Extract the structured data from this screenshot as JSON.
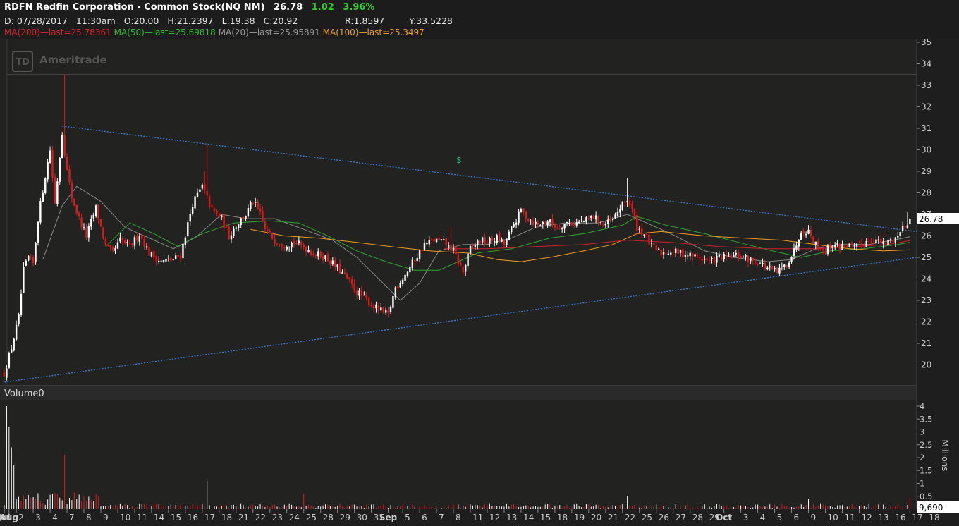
{
  "header": {
    "symbol": "RDFN",
    "company": "Redfin Corporation - Common Stock(NQ NM)",
    "last": "26.78",
    "change": "1.02",
    "change_pct": "3.96%",
    "date_label": "D:",
    "date": "07/28/2017",
    "time": "11:30am",
    "open": "O:20.00",
    "high": "H:21.2397",
    "low": "L:19.38",
    "close": "C:20.92",
    "r": "R:1.8597",
    "y": "Y:33.5228"
  },
  "studies": [
    {
      "label": "MA(200)",
      "value": "last=25.78361",
      "color": "#e0222a"
    },
    {
      "label": "MA(50)",
      "value": "last=25.69818",
      "color": "#2fbf2f"
    },
    {
      "label": "MA(20)",
      "value": "last=25.95891",
      "color": "#9a9a9a"
    },
    {
      "label": "MA(100)",
      "value": "last=25.3497",
      "color": "#f0a020"
    }
  ],
  "watermark": "Ameritrade",
  "watermark_logo": "TD",
  "dividend_marker": "$",
  "volume_label": "Volume",
  "volume_value": "0",
  "volume_units": "Millions",
  "volume_last": "9,690",
  "last_price_tag": "26.78",
  "colors": {
    "up": "#ffffff",
    "down": "#e01818",
    "trend": "#3a7fd8",
    "bg": "#1e1e1e"
  },
  "chart_data": {
    "type": "candlestick",
    "price_axis": {
      "min": 19,
      "max": 35,
      "ticks": [
        20,
        21,
        22,
        23,
        24,
        25,
        26,
        27,
        28,
        29,
        30,
        31,
        32,
        33,
        34,
        35
      ]
    },
    "volume_axis": {
      "min": 0,
      "max": 4,
      "ticks": [
        0.5,
        1,
        1.5,
        2,
        2.5,
        3,
        3.5,
        4
      ]
    },
    "x_ticks": [
      {
        "label": "Jul",
        "bar": 0
      },
      {
        "label": "Aug",
        "bar": 2
      },
      {
        "label": "2",
        "bar": 5
      },
      {
        "label": "3",
        "bar": 12
      },
      {
        "label": "4",
        "bar": 19
      },
      {
        "label": "7",
        "bar": 26
      },
      {
        "label": "8",
        "bar": 33
      },
      {
        "label": "9",
        "bar": 40
      },
      {
        "label": "10",
        "bar": 47
      },
      {
        "label": "11",
        "bar": 54
      },
      {
        "label": "14",
        "bar": 61
      },
      {
        "label": "15",
        "bar": 68
      },
      {
        "label": "16",
        "bar": 75
      },
      {
        "label": "17",
        "bar": 82
      },
      {
        "label": "18",
        "bar": 89
      },
      {
        "label": "21",
        "bar": 96
      },
      {
        "label": "22",
        "bar": 103
      },
      {
        "label": "23",
        "bar": 110
      },
      {
        "label": "24",
        "bar": 117
      },
      {
        "label": "25",
        "bar": 124
      },
      {
        "label": "28",
        "bar": 131
      },
      {
        "label": "29",
        "bar": 138
      },
      {
        "label": "30",
        "bar": 145
      },
      {
        "label": "31",
        "bar": 152
      },
      {
        "label": "Sep",
        "bar": 159
      },
      {
        "label": "5",
        "bar": 165
      },
      {
        "label": "6",
        "bar": 172
      },
      {
        "label": "7",
        "bar": 179
      },
      {
        "label": "8",
        "bar": 186
      },
      {
        "label": "11",
        "bar": 193
      },
      {
        "label": "12",
        "bar": 200
      },
      {
        "label": "13",
        "bar": 207
      },
      {
        "label": "14",
        "bar": 214
      },
      {
        "label": "15",
        "bar": 221
      },
      {
        "label": "18",
        "bar": 228
      },
      {
        "label": "19",
        "bar": 235
      },
      {
        "label": "20",
        "bar": 242
      },
      {
        "label": "21",
        "bar": 249
      },
      {
        "label": "22",
        "bar": 256
      },
      {
        "label": "25",
        "bar": 263
      },
      {
        "label": "26",
        "bar": 270
      },
      {
        "label": "27",
        "bar": 277
      },
      {
        "label": "28",
        "bar": 284
      },
      {
        "label": "29",
        "bar": 291
      },
      {
        "label": "Oct",
        "bar": 298
      },
      {
        "label": "3",
        "bar": 305
      },
      {
        "label": "4",
        "bar": 312
      },
      {
        "label": "5",
        "bar": 319
      },
      {
        "label": "6",
        "bar": 326
      },
      {
        "label": "9",
        "bar": 333
      },
      {
        "label": "10",
        "bar": 340
      },
      {
        "label": "11",
        "bar": 347
      },
      {
        "label": "12",
        "bar": 354
      },
      {
        "label": "13",
        "bar": 361
      },
      {
        "label": "16",
        "bar": 368
      },
      {
        "label": "17",
        "bar": 375
      },
      {
        "label": "18",
        "bar": 382
      }
    ],
    "anchors": [
      [
        0,
        19.6
      ],
      [
        3,
        20.8
      ],
      [
        6,
        22.2
      ],
      [
        8,
        24.4
      ],
      [
        10,
        25.0
      ],
      [
        12,
        24.7
      ],
      [
        14,
        26.8
      ],
      [
        17,
        28.8
      ],
      [
        19,
        30.0
      ],
      [
        21,
        27.5
      ],
      [
        24,
        30.8
      ],
      [
        26,
        29.0
      ],
      [
        28,
        27.8
      ],
      [
        31,
        26.8
      ],
      [
        34,
        26.0
      ],
      [
        38,
        27.3
      ],
      [
        42,
        25.5
      ],
      [
        45,
        25.2
      ],
      [
        48,
        25.8
      ],
      [
        52,
        25.5
      ],
      [
        56,
        26.1
      ],
      [
        60,
        25.2
      ],
      [
        65,
        24.8
      ],
      [
        70,
        24.9
      ],
      [
        73,
        25.1
      ],
      [
        78,
        27.5
      ],
      [
        82,
        28.3
      ],
      [
        86,
        27.2
      ],
      [
        90,
        26.8
      ],
      [
        93,
        26.0
      ],
      [
        96,
        26.5
      ],
      [
        100,
        27.0
      ],
      [
        103,
        27.6
      ],
      [
        106,
        27.0
      ],
      [
        108,
        26.3
      ],
      [
        112,
        25.8
      ],
      [
        116,
        25.6
      ],
      [
        120,
        25.7
      ],
      [
        124,
        25.5
      ],
      [
        128,
        25.2
      ],
      [
        133,
        25.0
      ],
      [
        138,
        24.5
      ],
      [
        142,
        24.0
      ],
      [
        145,
        23.5
      ],
      [
        148,
        23.2
      ],
      [
        152,
        22.8
      ],
      [
        156,
        22.5
      ],
      [
        159,
        22.3
      ],
      [
        162,
        23.6
      ],
      [
        166,
        24.2
      ],
      [
        170,
        24.9
      ],
      [
        174,
        25.6
      ],
      [
        178,
        25.8
      ],
      [
        182,
        25.7
      ],
      [
        186,
        25.3
      ],
      [
        190,
        24.3
      ],
      [
        193,
        25.4
      ],
      [
        197,
        25.8
      ],
      [
        200,
        25.7
      ],
      [
        204,
        25.9
      ],
      [
        207,
        25.6
      ],
      [
        210,
        26.3
      ],
      [
        214,
        27.2
      ],
      [
        217,
        26.8
      ],
      [
        221,
        26.5
      ],
      [
        225,
        26.7
      ],
      [
        229,
        26.4
      ],
      [
        233,
        26.6
      ],
      [
        237,
        26.6
      ],
      [
        241,
        26.7
      ],
      [
        244,
        26.9
      ],
      [
        248,
        26.5
      ],
      [
        252,
        26.7
      ],
      [
        255,
        27.3
      ],
      [
        258,
        27.7
      ],
      [
        260,
        27.2
      ],
      [
        262,
        26.4
      ],
      [
        265,
        26.1
      ],
      [
        268,
        25.5
      ],
      [
        272,
        25.2
      ],
      [
        276,
        25.3
      ],
      [
        280,
        25.2
      ],
      [
        284,
        25.1
      ],
      [
        288,
        25.0
      ],
      [
        292,
        24.8
      ],
      [
        296,
        25.0
      ],
      [
        300,
        25.0
      ],
      [
        304,
        25.1
      ],
      [
        308,
        24.9
      ],
      [
        312,
        24.8
      ],
      [
        316,
        24.5
      ],
      [
        320,
        24.3
      ],
      [
        324,
        24.7
      ],
      [
        327,
        25.3
      ],
      [
        330,
        26.3
      ],
      [
        333,
        26.2
      ],
      [
        336,
        25.6
      ],
      [
        340,
        25.3
      ],
      [
        343,
        25.6
      ],
      [
        346,
        25.5
      ],
      [
        349,
        25.6
      ],
      [
        352,
        25.4
      ],
      [
        355,
        25.6
      ],
      [
        358,
        25.8
      ],
      [
        361,
        25.8
      ],
      [
        364,
        25.6
      ],
      [
        367,
        25.8
      ],
      [
        370,
        26.0
      ],
      [
        372,
        26.4
      ],
      [
        375,
        26.8
      ]
    ],
    "spikes": [
      {
        "bar": 25,
        "high": 33.5
      },
      {
        "bar": 84,
        "high": 30.2
      },
      {
        "bar": 83,
        "high": 29.0
      },
      {
        "bar": 185,
        "high": 26.4
      },
      {
        "bar": 258,
        "high": 28.7
      },
      {
        "bar": 333,
        "high": 26.5
      },
      {
        "bar": 374,
        "high": 27.1
      }
    ],
    "volume_spikes": [
      {
        "bar": 1,
        "vol": 4.0
      },
      {
        "bar": 2,
        "vol": 3.2
      },
      {
        "bar": 3,
        "vol": 2.4
      },
      {
        "bar": 4,
        "vol": 1.7
      },
      {
        "bar": 25,
        "vol": 2.1
      },
      {
        "bar": 84,
        "vol": 1.1
      },
      {
        "bar": 124,
        "vol": 0.6
      },
      {
        "bar": 258,
        "vol": 0.5
      },
      {
        "bar": 333,
        "vol": 0.4
      },
      {
        "bar": 375,
        "vol": 0.45
      }
    ],
    "trendlines": [
      {
        "from": [
          24,
          31.1
        ],
        "to": [
          390,
          26.2
        ]
      },
      {
        "from": [
          0,
          19.2
        ],
        "to": [
          390,
          25.0
        ]
      }
    ],
    "moving_averages": [
      {
        "name": "MA(20)",
        "color": "#8a8a8a",
        "points": [
          [
            16,
            24.9
          ],
          [
            24,
            27.4
          ],
          [
            30,
            28.3
          ],
          [
            40,
            27.6
          ],
          [
            50,
            26.4
          ],
          [
            60,
            25.9
          ],
          [
            70,
            25.4
          ],
          [
            80,
            26.0
          ],
          [
            90,
            27.0
          ],
          [
            100,
            26.8
          ],
          [
            112,
            26.8
          ],
          [
            124,
            26.3
          ],
          [
            136,
            25.8
          ],
          [
            146,
            25.0
          ],
          [
            156,
            23.9
          ],
          [
            164,
            23.0
          ],
          [
            172,
            23.8
          ],
          [
            180,
            25.3
          ],
          [
            190,
            25.6
          ],
          [
            200,
            25.6
          ],
          [
            210,
            25.9
          ],
          [
            220,
            26.4
          ],
          [
            232,
            26.6
          ],
          [
            246,
            26.6
          ],
          [
            258,
            27.0
          ],
          [
            266,
            26.6
          ],
          [
            276,
            26.1
          ],
          [
            290,
            25.3
          ],
          [
            302,
            25.0
          ],
          [
            316,
            24.8
          ],
          [
            326,
            24.9
          ],
          [
            336,
            25.4
          ],
          [
            346,
            25.6
          ],
          [
            358,
            25.6
          ],
          [
            368,
            25.8
          ],
          [
            375,
            25.96
          ]
        ]
      },
      {
        "name": "MA(50)",
        "color": "#2fa52f",
        "points": [
          [
            42,
            25.5
          ],
          [
            52,
            26.6
          ],
          [
            62,
            26.1
          ],
          [
            72,
            25.5
          ],
          [
            82,
            26.1
          ],
          [
            95,
            26.6
          ],
          [
            110,
            26.7
          ],
          [
            122,
            26.6
          ],
          [
            134,
            26.0
          ],
          [
            146,
            25.3
          ],
          [
            158,
            24.8
          ],
          [
            170,
            24.4
          ],
          [
            180,
            24.4
          ],
          [
            196,
            25.2
          ],
          [
            210,
            25.4
          ],
          [
            226,
            25.9
          ],
          [
            240,
            26.1
          ],
          [
            256,
            26.5
          ],
          [
            262,
            26.9
          ],
          [
            274,
            26.5
          ],
          [
            290,
            26.1
          ],
          [
            304,
            25.7
          ],
          [
            318,
            25.3
          ],
          [
            330,
            25.0
          ],
          [
            342,
            25.3
          ],
          [
            356,
            25.4
          ],
          [
            370,
            25.6
          ],
          [
            375,
            25.7
          ]
        ]
      },
      {
        "name": "MA(100)",
        "color": "#f09a20",
        "points": [
          [
            102,
            26.3
          ],
          [
            116,
            26.0
          ],
          [
            130,
            25.9
          ],
          [
            146,
            25.7
          ],
          [
            160,
            25.5
          ],
          [
            176,
            25.3
          ],
          [
            192,
            25.2
          ],
          [
            204,
            24.9
          ],
          [
            214,
            24.8
          ],
          [
            226,
            25.0
          ],
          [
            240,
            25.3
          ],
          [
            252,
            25.6
          ],
          [
            262,
            26.1
          ],
          [
            272,
            26.2
          ],
          [
            290,
            26.0
          ],
          [
            306,
            25.9
          ],
          [
            322,
            25.8
          ],
          [
            336,
            25.6
          ],
          [
            350,
            25.4
          ],
          [
            364,
            25.3
          ],
          [
            375,
            25.35
          ]
        ]
      },
      {
        "name": "MA(200)",
        "color": "#d02028",
        "points": [
          [
            182,
            25.4
          ],
          [
            200,
            25.4
          ],
          [
            220,
            25.5
          ],
          [
            240,
            25.6
          ],
          [
            258,
            25.8
          ],
          [
            276,
            25.7
          ],
          [
            296,
            25.5
          ],
          [
            316,
            25.4
          ],
          [
            336,
            25.4
          ],
          [
            352,
            25.5
          ],
          [
            366,
            25.6
          ],
          [
            375,
            25.78
          ]
        ]
      }
    ]
  }
}
